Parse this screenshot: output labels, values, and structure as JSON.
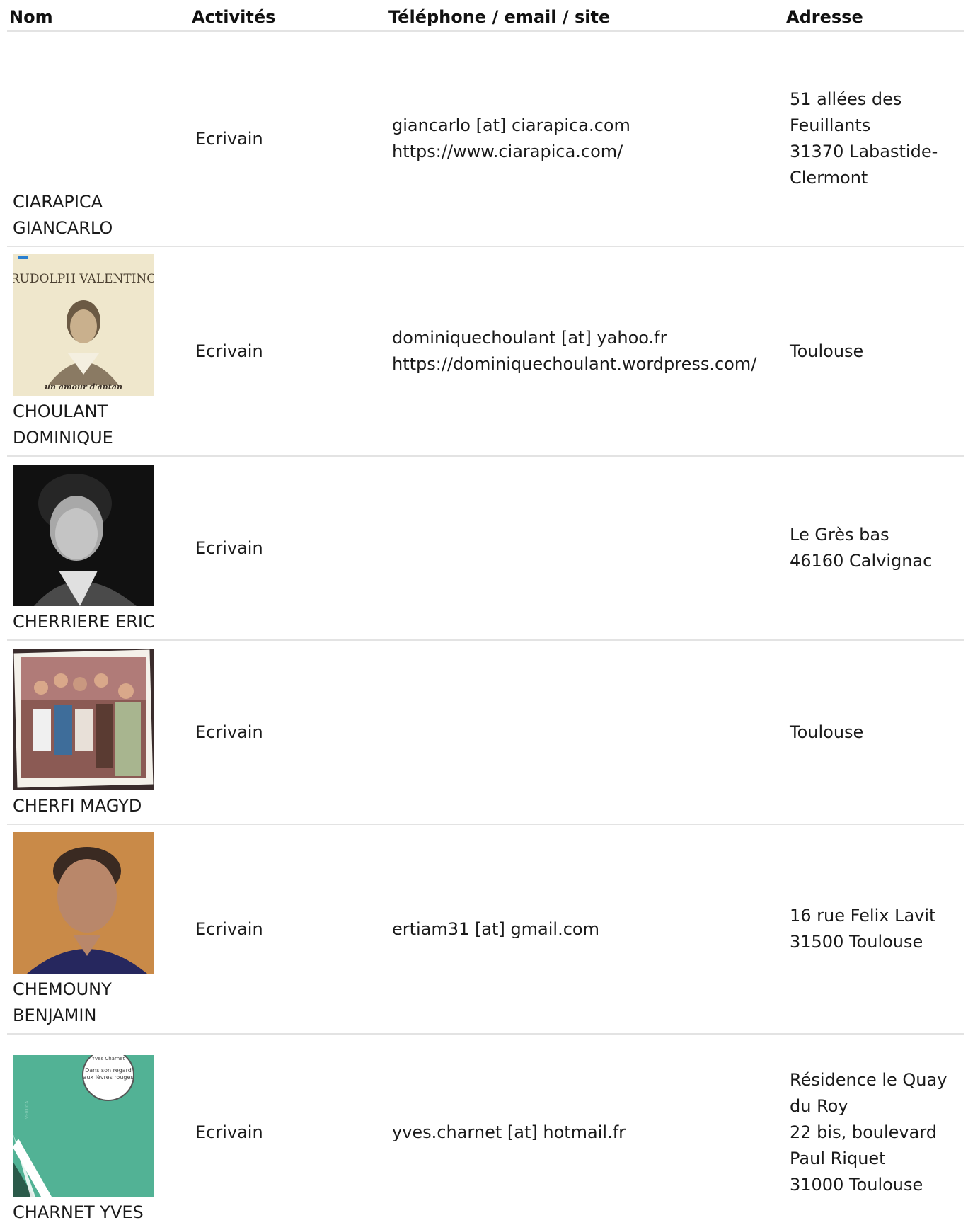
{
  "headers": {
    "nom": "Nom",
    "activites": "Activités",
    "contact": "Téléphone / email / site",
    "adresse": "Adresse"
  },
  "rows": [
    {
      "name": "CIARAPICA GIANCARLO",
      "activity": "Ecrivain",
      "contact": [
        "giancarlo [at] ciarapica.com",
        "https://www.ciarapica.com/"
      ],
      "address": [
        "51 allées des",
        "Feuillants",
        "31370 Labastide-",
        "Clermont"
      ]
    },
    {
      "name": "CHOULANT DOMINIQUE",
      "activity": "Ecrivain",
      "contact": [
        "dominiquechoulant [at] yahoo.fr",
        "https://dominiquechoulant.wordpress.com/"
      ],
      "address": [
        "Toulouse"
      ],
      "photo": {
        "title_lines": [
          "RUDOLPH VALENTINO"
        ],
        "caption": "un amour d'antan"
      }
    },
    {
      "name": "CHERRIERE ERIC",
      "activity": "Ecrivain",
      "contact": [],
      "address": [
        "Le Grès bas",
        "46160 Calvignac"
      ]
    },
    {
      "name": "CHERFI MAGYD",
      "activity": "Ecrivain",
      "contact": [],
      "address": [
        "Toulouse"
      ]
    },
    {
      "name": "CHEMOUNY BENJAMIN",
      "activity": "Ecrivain",
      "contact": [
        "ertiam31 [at] gmail.com"
      ],
      "address": [
        "16 rue Felix Lavit",
        "31500 Toulouse"
      ]
    },
    {
      "name": "CHARNET YVES",
      "activity": "Ecrivain",
      "contact": [
        "yves.charnet [at] hotmail.fr"
      ],
      "address": [
        "Résidence le Quay",
        "du Roy",
        "22 bis, boulevard",
        "Paul Riquet",
        "31000 Toulouse"
      ],
      "photo": {
        "author": "Yves Charnet",
        "title_lines": [
          "Dans son regard",
          "aux lèvres rouges"
        ],
        "spine": "VERTICAL"
      }
    }
  ],
  "colors": {
    "border": "#e3e3e3",
    "cover_green": "#52b295",
    "sepia": "#efe7cc"
  }
}
